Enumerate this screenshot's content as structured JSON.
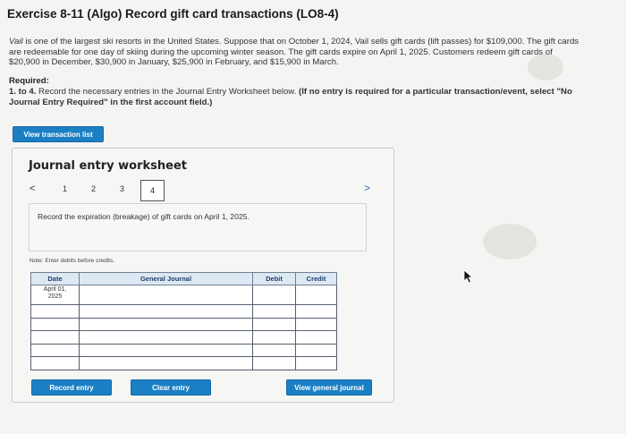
{
  "header": {
    "title": "Exercise 8-11 (Algo) Record gift card transactions (LO8-4)"
  },
  "problem": {
    "company": "Vail",
    "text_after_company": " is one of the largest ski resorts in the United States. Suppose that on October 1, 2024, Vail sells gift cards (lift passes) for $109,000. The gift cards are redeemable for one day of skiing during the upcoming winter season. The gift cards expire on April 1, 2025. Customers redeem gift cards of $20,900 in December, $30,900 in January, $25,900 in February, and $15,900 in March."
  },
  "required": {
    "heading": "Required:",
    "range": "1. to 4.",
    "text": " Record the necessary entries in the Journal Entry Worksheet below. ",
    "bold_note": "(If no entry is required for a particular transaction/event, select \"No Journal Entry Required\" in the first account field.)"
  },
  "buttons": {
    "view_transaction_list": "View transaction list",
    "record_entry": "Record entry",
    "clear_entry": "Clear entry",
    "view_general_journal": "View general journal"
  },
  "worksheet": {
    "title": "Journal entry worksheet",
    "nav_prev": "<",
    "nav_next": ">",
    "pages": [
      "1",
      "2",
      "3",
      "4"
    ],
    "active_page": "4",
    "instruction": "Record the expiration (breakage) of gift cards on April 1, 2025.",
    "note": "Note: Enter debits before credits."
  },
  "journal": {
    "headers": {
      "date": "Date",
      "general_journal": "General Journal",
      "debit": "Debit",
      "credit": "Credit"
    },
    "date_line1": "April 01,",
    "date_line2": "2025"
  }
}
